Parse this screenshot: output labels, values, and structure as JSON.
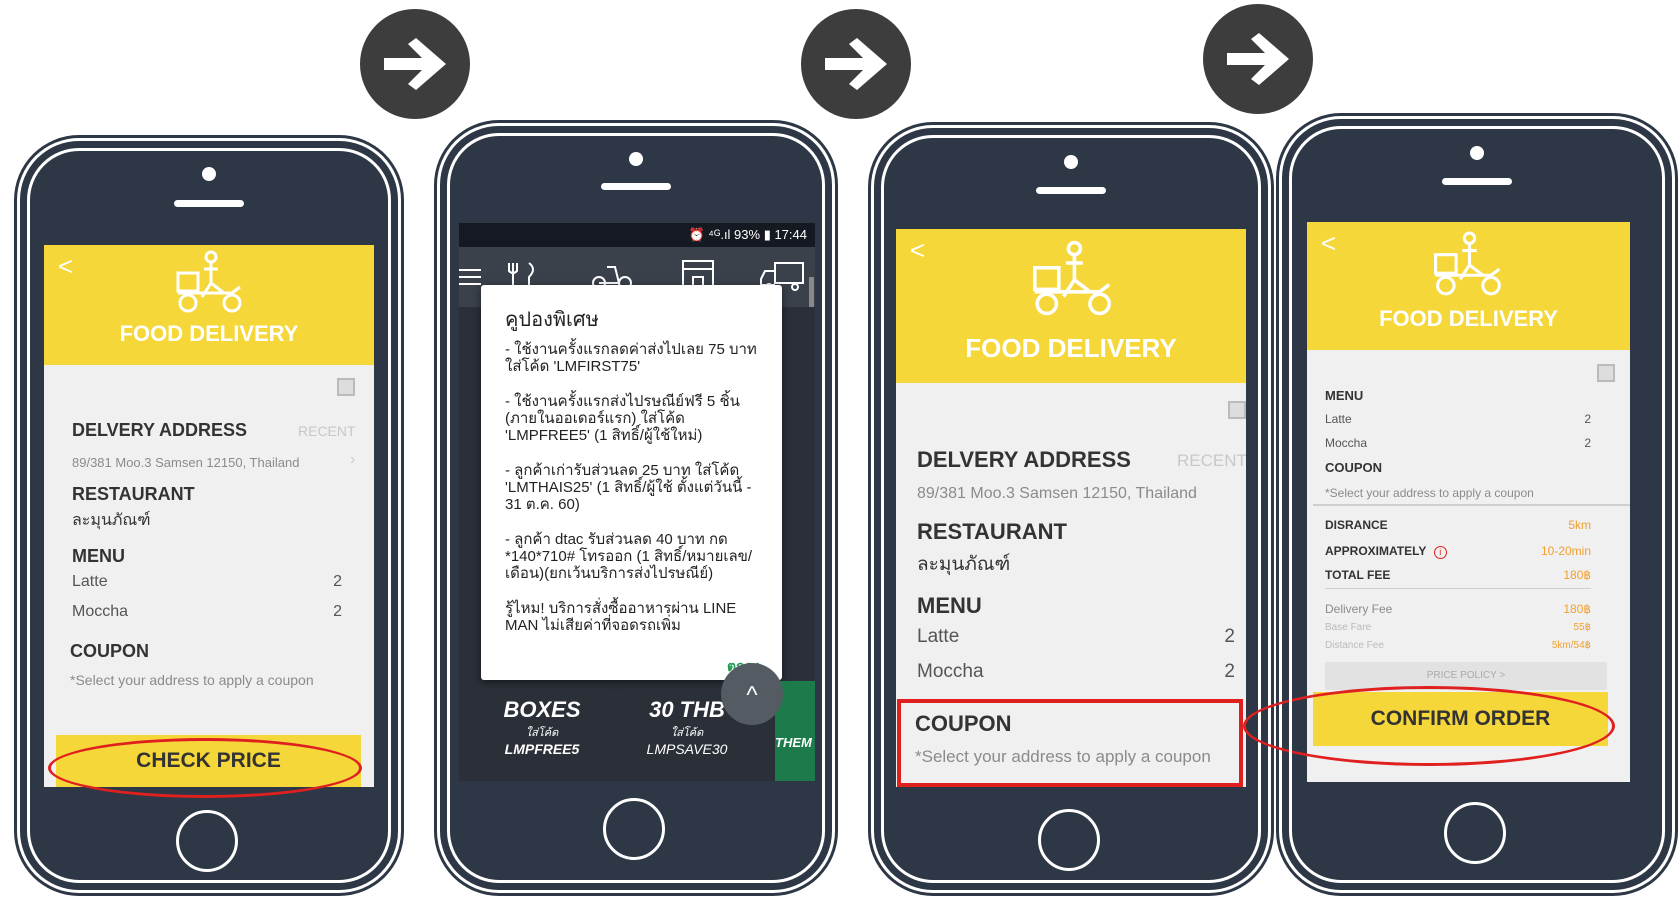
{
  "app": {
    "banner_title": "FOOD DELIVERY",
    "back_glyph": "<",
    "icons": [
      "arrow-right-icon",
      "delivery-scooter-icon",
      "back-chevron-icon",
      "map-icon",
      "chevron-right-icon",
      "info-icon",
      "cutlery-icon",
      "scooter-icon",
      "store-icon",
      "truck-icon",
      "menu-icon",
      "alarm-icon",
      "signal-icon",
      "battery-icon"
    ]
  },
  "colors": {
    "brand_yellow": "#f5d73a",
    "phone_body": "#2d3746",
    "accent_orange": "#f0a030",
    "highlight_red": "#e0201f",
    "arrow_bg": "#3d3d3d",
    "ok_green": "#1f9a52"
  },
  "screen1": {
    "delivery_address_label": "DELVERY ADDRESS",
    "recent_label": "RECENT",
    "address": "89/381 Moo.3 Samsen 12150, Thailand",
    "restaurant_label": "RESTAURANT",
    "restaurant_name": "ละมุนภัณฑ์",
    "menu_label": "MENU",
    "menu_items": [
      {
        "name": "Latte",
        "qty": "2"
      },
      {
        "name": "Moccha",
        "qty": "2"
      }
    ],
    "coupon_label": "COUPON",
    "coupon_hint": "*Select your address to apply a coupon",
    "check_price_label": "CHECK PRICE"
  },
  "screen2": {
    "status_bar": "⏰ ⁴ᴳ.ıl 93% ▮ 17:44",
    "dialog_title": "คูปองพิเศษ",
    "paragraphs": [
      "- ใช้งานครั้งแรกลดค่าส่งไปเลย 75 บาท ใส่โค้ด 'LMFIRST75'",
      "- ใช้งานครั้งแรกส่งไปรษณีย์ฟรี 5 ชิ้น (ภายในออเดอร์แรก) ใส่โค้ด 'LMPFREE5' (1 สิทธิ์/ผู้ใช้ใหม่)",
      "- ลูกค้าเก่ารับส่วนลด 25 บาท ใส่โค้ด 'LMTHAIS25' (1 สิทธิ์/ผู้ใช้ ตั้งแต่วันนี้ - 31 ต.ค. 60)",
      "- ลูกค้า dtac รับส่วนลด 40 บาท กด *140*710# โทรออก (1 สิทธิ์/หมายเลข/เดือน)(ยกเว้นบริการส่งไปรษณีย์)",
      "รู้ไหม! บริการสั่งซื้ออาหารผ่าน LINE MAN ไม่เสียค่าที่จอดรถเพิ่ม"
    ],
    "ok_label": "ตกลง",
    "promo_left_big": "BOXES",
    "promo_left_small": "ใส่โค้ด",
    "promo_left_code": "LMPFREE5",
    "promo_right_big": "30 THB",
    "promo_right_small": "ใส่โค้ด",
    "promo_right_code": "LMPSAVE30",
    "promo_edge": "THEM",
    "scroll_up_glyph": "^"
  },
  "screen3": {
    "delivery_address_label": "DELVERY ADDRESS",
    "recent_label": "RECENT",
    "address": "89/381 Moo.3 Samsen 12150, Thailand",
    "restaurant_label": "RESTAURANT",
    "restaurant_name": "ละมุนภัณฑ์",
    "menu_label": "MENU",
    "menu_items": [
      {
        "name": "Latte",
        "qty": "2"
      },
      {
        "name": "Moccha",
        "qty": "2"
      }
    ],
    "coupon_label": "COUPON",
    "coupon_hint": "*Select your address to apply a coupon"
  },
  "screen4": {
    "menu_label": "MENU",
    "menu_items": [
      {
        "name": "Latte",
        "qty": "2"
      },
      {
        "name": "Moccha",
        "qty": "2"
      }
    ],
    "coupon_label": "COUPON",
    "coupon_hint": "*Select your address to apply a coupon",
    "distance_label": "DISRANCE",
    "distance_value": "5km",
    "approx_label": "APPROXIMATELY",
    "approx_value": "10-20min",
    "total_label": "TOTAL FEE",
    "total_value": "180฿",
    "delivery_fee_label": "Delivery Fee",
    "delivery_fee_value": "180฿",
    "base_fare_label": "Base Fare",
    "base_fare_value": "55฿",
    "distance_fee_label": "Distance Fee",
    "distance_fee_value": "5km/54฿",
    "price_policy_label": "PRICE POLICY >",
    "confirm_label": "CONFIRM ORDER"
  }
}
